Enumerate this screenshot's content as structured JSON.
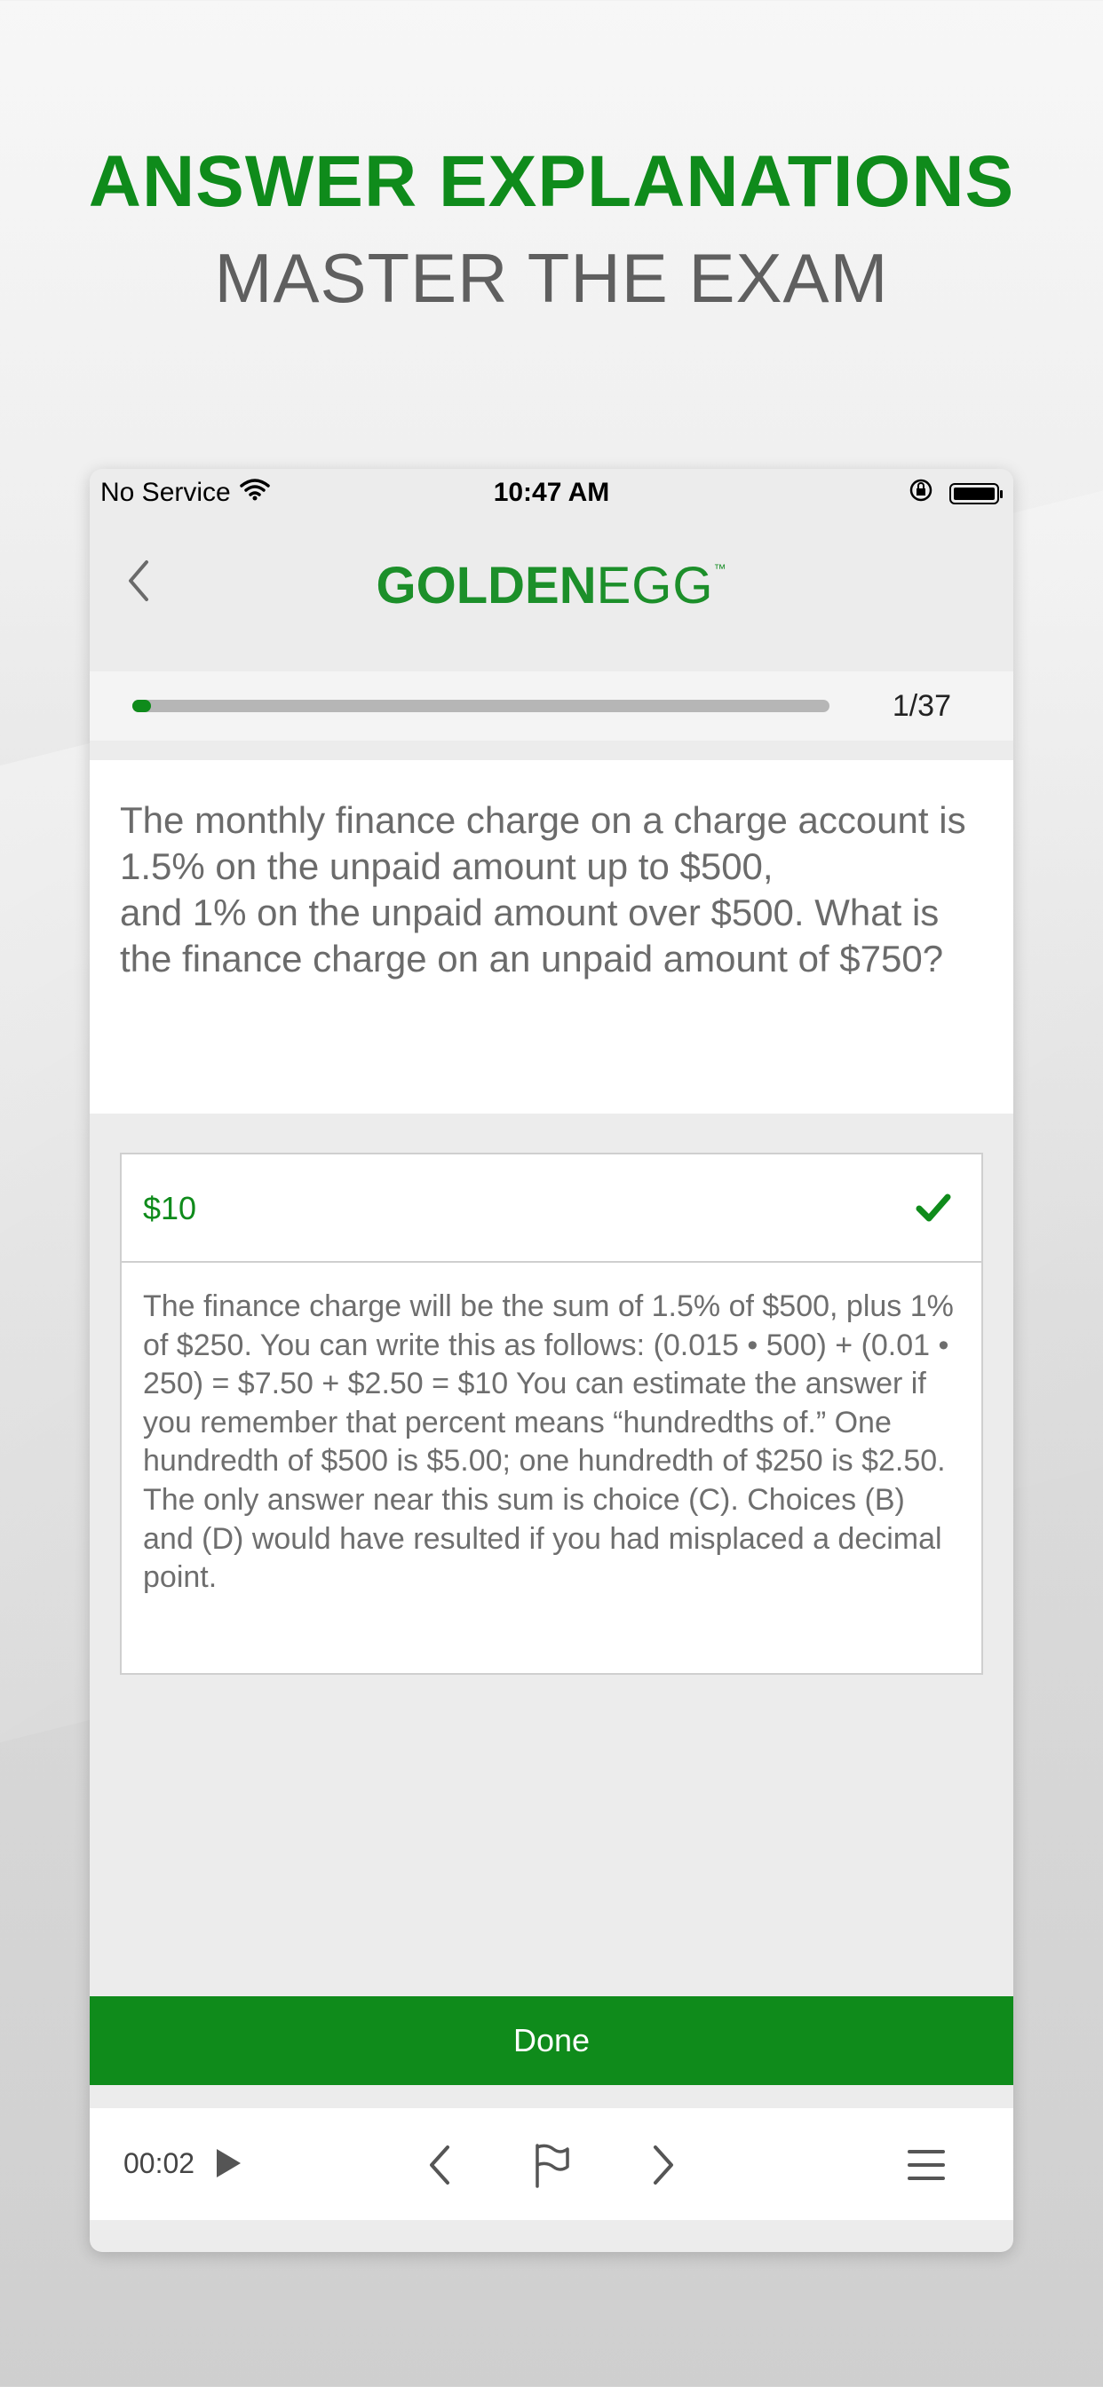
{
  "marketing": {
    "headline": "ANSWER EXPLANATIONS",
    "subheadline": "MASTER THE EXAM"
  },
  "status_bar": {
    "carrier": "No Service",
    "time": "10:47 AM",
    "icons": [
      "wifi-icon",
      "orientation-lock-icon",
      "battery-icon"
    ]
  },
  "nav": {
    "logo_bold": "GOLDEN",
    "logo_thin": "EGG",
    "logo_tm": "™",
    "back_icon": "chevron-left-icon"
  },
  "progress": {
    "count": "1/37",
    "fraction": 0.027
  },
  "question": {
    "text": "The monthly finance charge on a charge account is 1.5% on the unpaid amount up to $500,\nand 1% on the unpaid amount over $500. What is the finance charge on an unpaid amount of $750?"
  },
  "answer": {
    "label": "$10",
    "status_icon": "checkmark-icon",
    "explanation": "The finance charge will be the sum of 1.5% of $500, plus 1% of $250. You can write this as follows: (0.015 • 500) + (0.01 • 250) = $7.50 + $2.50 = $10 You can estimate the answer if you remember that percent means “hundredths of.” One hundredth of $500 is $5.00; one hundredth of $250 is $2.50. The only answer near this sum is choice (C). Choices (B) and (D) would have resulted if you had misplaced a decimal point."
  },
  "done_button": {
    "label": "Done"
  },
  "toolbar": {
    "timer": "00:02",
    "icons": [
      "play-icon",
      "previous-icon",
      "flag-icon",
      "next-icon",
      "menu-icon"
    ]
  },
  "colors": {
    "brand_green": "#0f8b1b",
    "text_gray": "#6b6b6b"
  }
}
